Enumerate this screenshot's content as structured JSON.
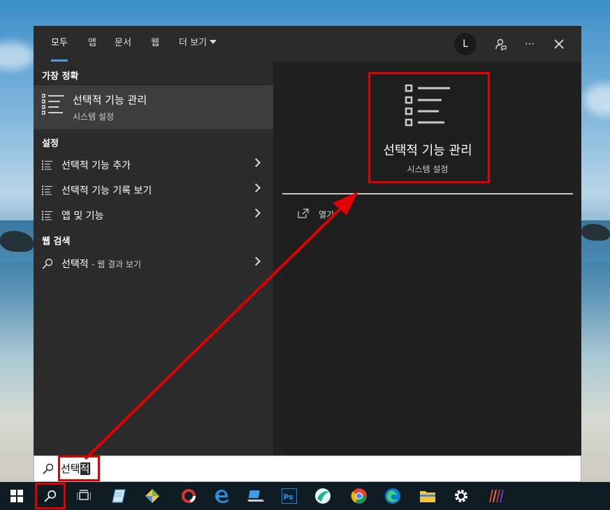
{
  "tabs": [
    {
      "label": "모두"
    },
    {
      "label": "앱"
    },
    {
      "label": "문서"
    },
    {
      "label": "웹"
    },
    {
      "label": "더 보기"
    }
  ],
  "top_actions": {
    "avatar_letter": "L",
    "more": "···"
  },
  "sections": {
    "best_match": "가장 정확",
    "settings": "설정",
    "web_search": "웹 검색"
  },
  "best_match": {
    "title": "선택적 기능 관리",
    "subtitle": "시스템 설정"
  },
  "settings_items": [
    {
      "label": "선택적 기능 추가"
    },
    {
      "label": "선택적 기능 기록 보기"
    },
    {
      "label": "앱 및 기능"
    }
  ],
  "web_item": {
    "query": "선택적",
    "suffix": "- 웹 결과 보기"
  },
  "detail": {
    "title": "선택적 기능 관리",
    "subtitle": "시스템 설정",
    "open_label": "열기"
  },
  "search": {
    "typed": "선택",
    "selected": "적"
  },
  "colors": {
    "accent": "#4d9ee8",
    "annotation": "#e00000",
    "panel": "#2b2b2b",
    "selected": "#3d3d3d"
  },
  "taskbar_icons": [
    "windows-start-icon",
    "search-icon",
    "task-view-icon",
    "notepad-icon",
    "app-icon",
    "backup-icon",
    "edge-legacy-icon",
    "laptop-icon",
    "photoshop-icon",
    "app-icon-teal",
    "chrome-icon",
    "edge-icon",
    "file-explorer-icon",
    "settings-gear-icon",
    "app-icon-stripes"
  ]
}
